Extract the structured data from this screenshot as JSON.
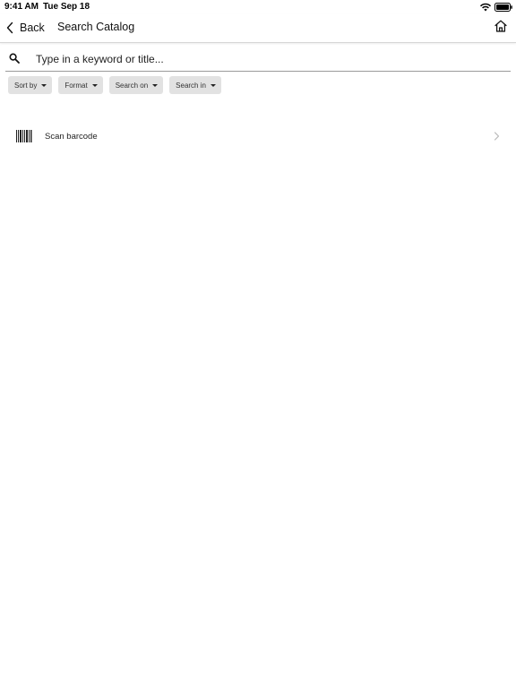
{
  "status_bar": {
    "time": "9:41 AM",
    "date": "Tue Sep 18",
    "icons": [
      "wifi-icon",
      "battery-icon"
    ]
  },
  "nav": {
    "back_label": "Back",
    "title": "Search Catalog",
    "icons": [
      "chevron-left-icon",
      "home-icon"
    ]
  },
  "search": {
    "placeholder": "Type in a keyword or title...",
    "value": "",
    "icon": "search-icon"
  },
  "filters": [
    {
      "label": "Sort by"
    },
    {
      "label": "Format"
    },
    {
      "label": "Search on"
    },
    {
      "label": "Search in"
    }
  ],
  "scan": {
    "label": "Scan barcode",
    "icon": "barcode-icon"
  },
  "colors": {
    "chip_background": "#e2e2e2",
    "text": "#111111",
    "divider": "#d6d6d6"
  }
}
